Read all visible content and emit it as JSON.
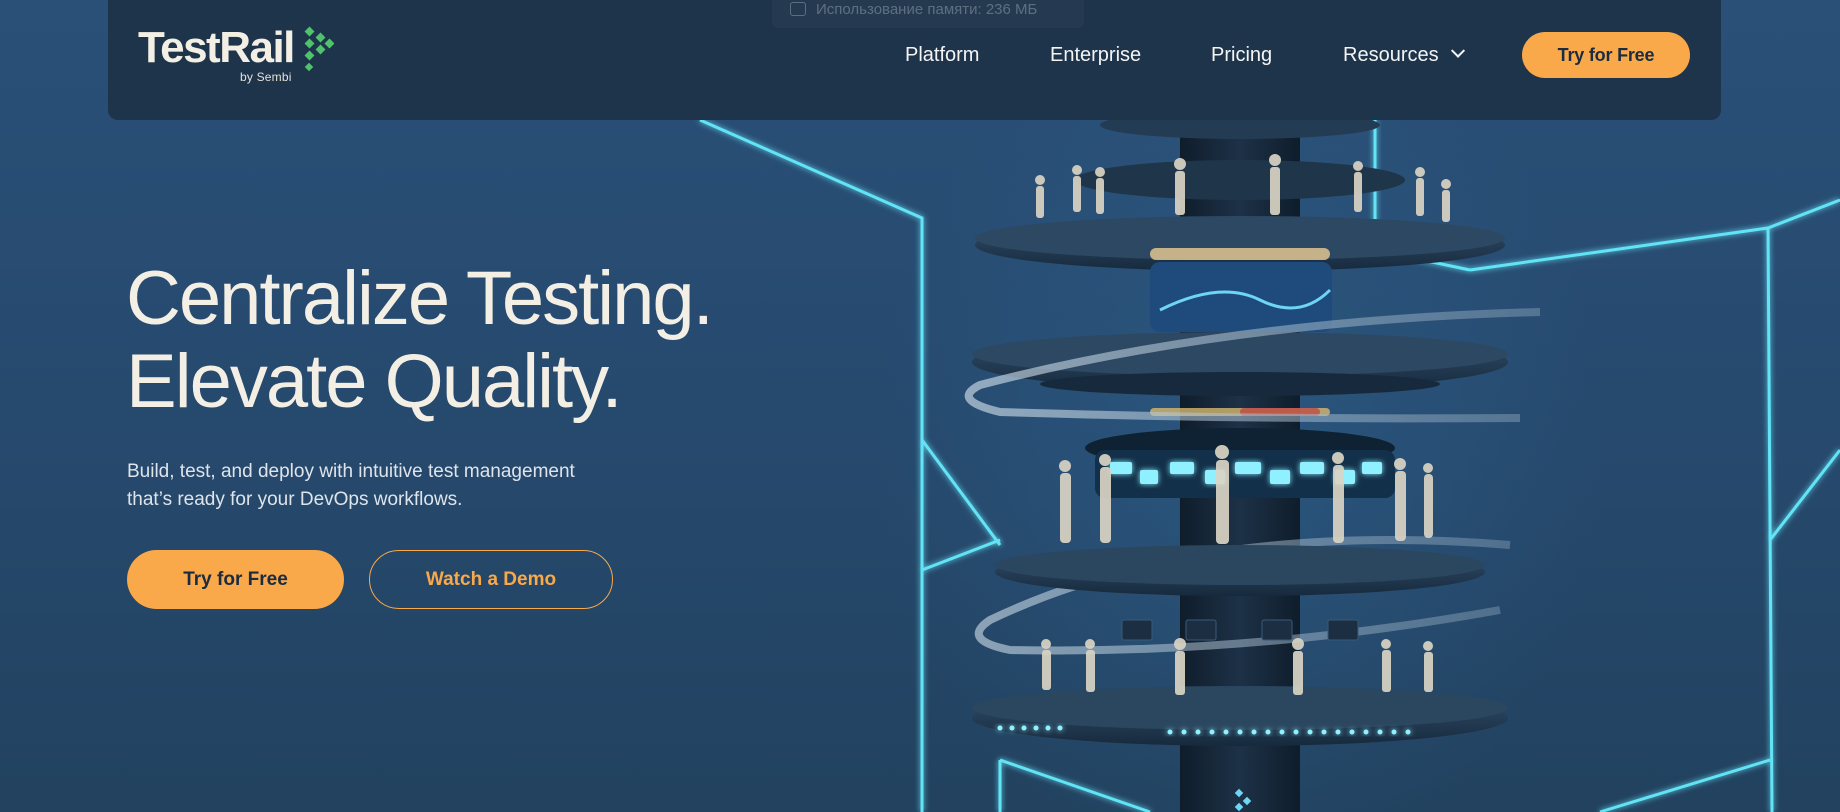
{
  "tooltip": {
    "text": "Использование памяти: 236 МБ"
  },
  "brand": {
    "name": "TestRail",
    "sub": "by Sembi",
    "accent": "#f9a84a",
    "mark_color": "#4fc36b"
  },
  "nav": {
    "items": [
      {
        "label": "Platform"
      },
      {
        "label": "Enterprise"
      },
      {
        "label": "Pricing"
      },
      {
        "label": "Resources"
      }
    ],
    "cta": "Try for Free"
  },
  "hero": {
    "title_line1": "Centralize Testing.",
    "title_line2": "Elevate Quality.",
    "subtitle_line1": "Build, test, and deploy with intuitive test management",
    "subtitle_line2": "that’s ready for your DevOps workflows.",
    "primary_cta": "Try for Free",
    "secondary_cta": "Watch a Demo"
  }
}
